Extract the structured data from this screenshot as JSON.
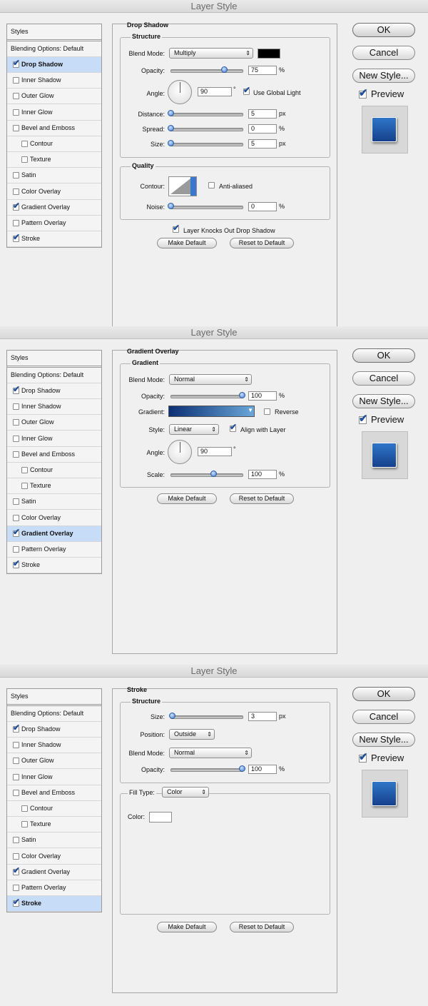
{
  "window_title": "Layer Style",
  "colors": {
    "selection": "#c7dcf7",
    "accent": "#3a78d0",
    "drop_shadow_color": "#000000",
    "gradient_start": "#0c2f74",
    "gradient_end": "#6aa7d8",
    "stroke_color": "#ffffff",
    "preview_top": "#2f76c8",
    "preview_bottom": "#16408c"
  },
  "styles_list": {
    "header": "Styles",
    "blending": "Blending Options: Default",
    "items": [
      {
        "label": "Drop Shadow",
        "checked": true,
        "indent": false
      },
      {
        "label": "Inner Shadow",
        "checked": false,
        "indent": false
      },
      {
        "label": "Outer Glow",
        "checked": false,
        "indent": false
      },
      {
        "label": "Inner Glow",
        "checked": false,
        "indent": false
      },
      {
        "label": "Bevel and Emboss",
        "checked": false,
        "indent": false
      },
      {
        "label": "Contour",
        "checked": false,
        "indent": true
      },
      {
        "label": "Texture",
        "checked": false,
        "indent": true
      },
      {
        "label": "Satin",
        "checked": false,
        "indent": false
      },
      {
        "label": "Color Overlay",
        "checked": false,
        "indent": false
      },
      {
        "label": "Gradient Overlay",
        "checked": true,
        "indent": false
      },
      {
        "label": "Pattern Overlay",
        "checked": false,
        "indent": false
      },
      {
        "label": "Stroke",
        "checked": true,
        "indent": false
      }
    ]
  },
  "buttons": {
    "ok": "OK",
    "cancel": "Cancel",
    "new_style": "New Style...",
    "preview": "Preview",
    "make_default": "Make Default",
    "reset_default": "Reset to Default"
  },
  "drop_shadow": {
    "title": "Drop Shadow",
    "structure": "Structure",
    "blend_mode_label": "Blend Mode:",
    "blend_mode": "Multiply",
    "opacity_label": "Opacity:",
    "opacity": "75",
    "opacity_fraction": 0.75,
    "percent": "%",
    "angle_label": "Angle:",
    "angle": "90",
    "degree": "°",
    "use_global_light": "Use Global Light",
    "distance_label": "Distance:",
    "distance": "5",
    "spread_label": "Spread:",
    "spread": "0",
    "size_label": "Size:",
    "size": "5",
    "px": "px",
    "quality": "Quality",
    "contour_label": "Contour:",
    "anti_aliased": "Anti-aliased",
    "noise_label": "Noise:",
    "noise": "0",
    "knocks_out": "Layer Knocks Out Drop Shadow"
  },
  "gradient_overlay": {
    "title": "Gradient Overlay",
    "gradient_group": "Gradient",
    "blend_mode_label": "Blend Mode:",
    "blend_mode": "Normal",
    "opacity_label": "Opacity:",
    "opacity": "100",
    "percent": "%",
    "gradient_label": "Gradient:",
    "reverse": "Reverse",
    "style_label": "Style:",
    "style": "Linear",
    "align_with_layer": "Align with Layer",
    "angle_label": "Angle:",
    "angle": "90",
    "degree": "°",
    "scale_label": "Scale:",
    "scale": "100"
  },
  "stroke": {
    "title": "Stroke",
    "structure": "Structure",
    "size_label": "Size:",
    "size": "3",
    "px": "px",
    "position_label": "Position:",
    "position": "Outside",
    "blend_mode_label": "Blend Mode:",
    "blend_mode": "Normal",
    "opacity_label": "Opacity:",
    "opacity": "100",
    "percent": "%",
    "fill_type_label": "Fill Type:",
    "fill_type": "Color",
    "color_label": "Color:"
  }
}
